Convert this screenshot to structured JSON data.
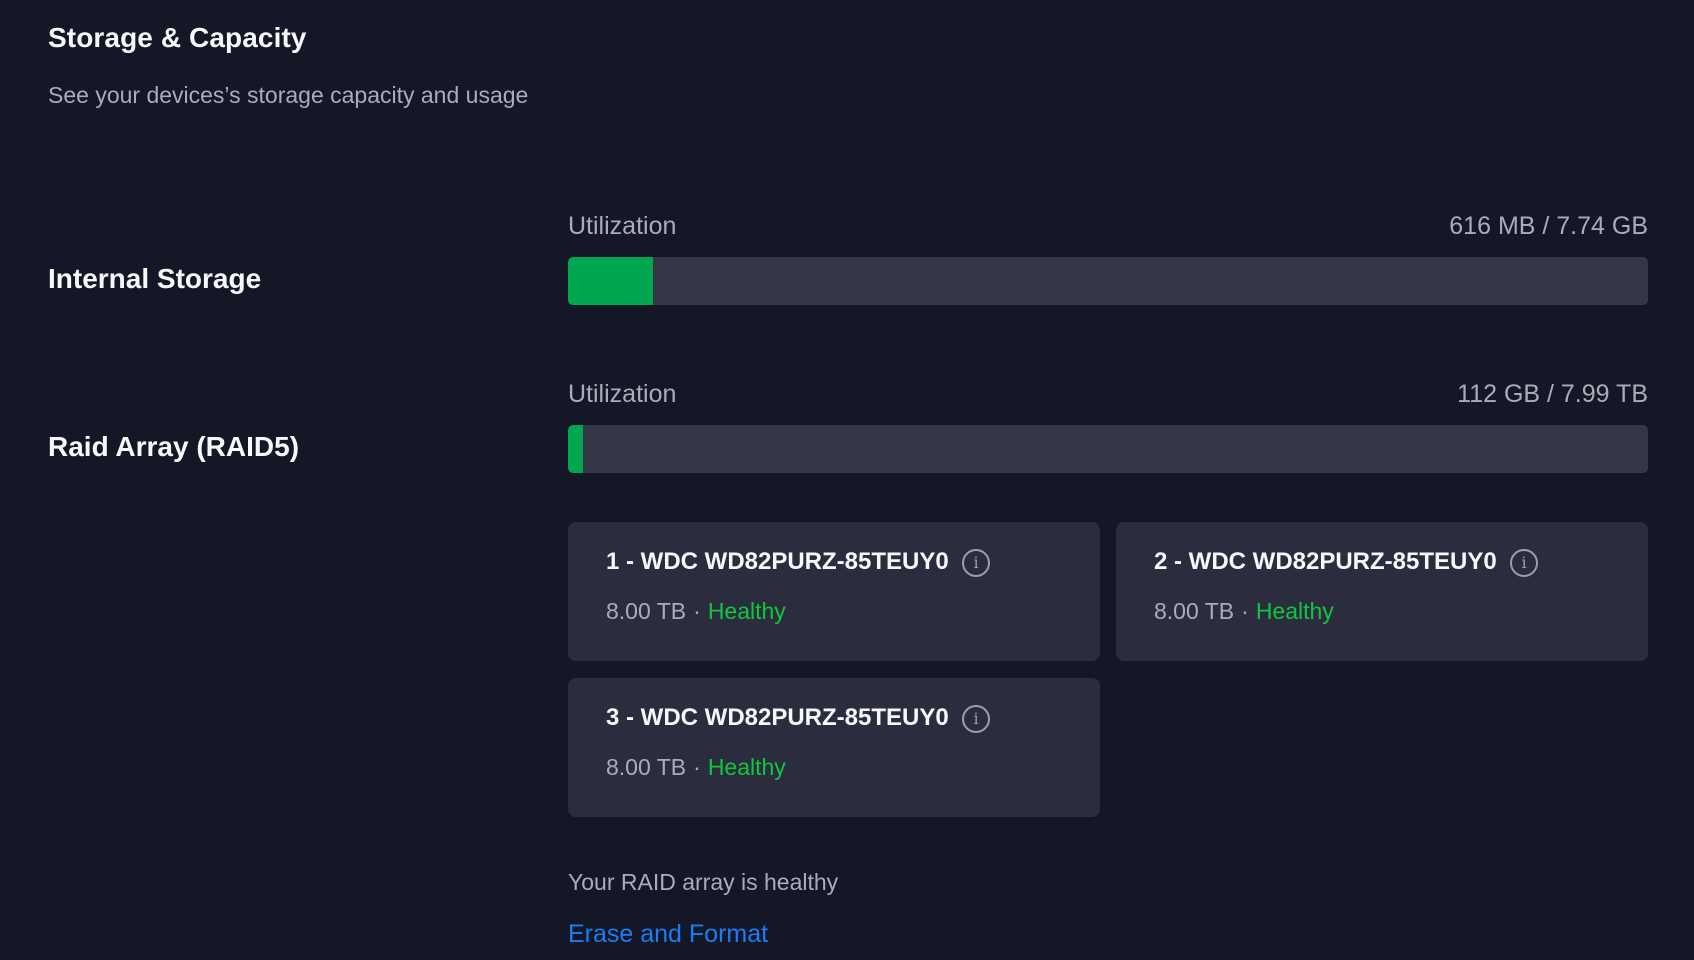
{
  "header": {
    "title": "Storage & Capacity",
    "subtitle": "See your devices’s storage capacity and usage"
  },
  "internal_storage": {
    "label": "Internal Storage",
    "utilization_label": "Utilization",
    "utilization_value": "616 MB / 7.74 GB",
    "fill_fraction": 0.079
  },
  "raid": {
    "label": "Raid Array (RAID5)",
    "utilization_label": "Utilization",
    "utilization_value": "112 GB / 7.99 TB",
    "fill_fraction": 0.014,
    "disks": [
      {
        "name": "1 - WDC WD82PURZ-85TEUY0",
        "capacity": "8.00 TB",
        "separator": "·",
        "status": "Healthy"
      },
      {
        "name": "2 - WDC WD82PURZ-85TEUY0",
        "capacity": "8.00 TB",
        "separator": "·",
        "status": "Healthy"
      },
      {
        "name": "3 - WDC WD82PURZ-85TEUY0",
        "capacity": "8.00 TB",
        "separator": "·",
        "status": "Healthy"
      }
    ],
    "info_glyph": "i",
    "health_message": "Your RAID array is healthy",
    "erase_label": "Erase and Format"
  },
  "colors": {
    "background": "#141726",
    "bar_track": "#353746",
    "bar_fill": "#00a650",
    "card": "#2b2d3f",
    "healthy": "#10c63a",
    "link": "#1b7cf5"
  },
  "icons": {
    "info": "info-circle-icon"
  }
}
